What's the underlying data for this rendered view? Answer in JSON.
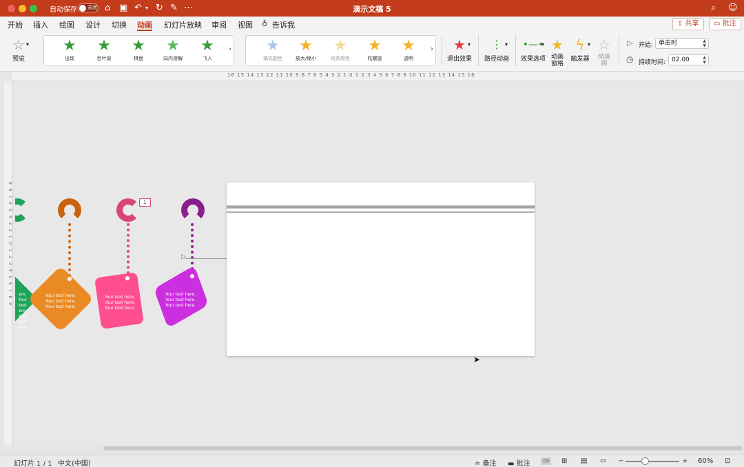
{
  "window": {
    "title": "演示文稿 5",
    "autosave_label": "自动保存",
    "autosave_state": "关闭",
    "traffic_lights": [
      "#f25f58",
      "#fbbc2e",
      "#33c748"
    ]
  },
  "tabs": [
    {
      "label": "开始"
    },
    {
      "label": "插入"
    },
    {
      "label": "绘图"
    },
    {
      "label": "设计"
    },
    {
      "label": "切换"
    },
    {
      "label": "动画",
      "active": true
    },
    {
      "label": "幻灯片放映"
    },
    {
      "label": "审阅"
    },
    {
      "label": "视图"
    },
    {
      "label": "告诉我"
    }
  ],
  "header_buttons": {
    "share": "共享",
    "comment": "批注"
  },
  "ribbon": {
    "preview": "预览",
    "entrance_effects": [
      {
        "label": "出现",
        "color": "#3a9b3a"
      },
      {
        "label": "百叶窗",
        "color": "#3a9b3a"
      },
      {
        "label": "棋盘",
        "color": "#3a9b3a"
      },
      {
        "label": "向内溶解",
        "color": "#5cb85c"
      },
      {
        "label": "飞入",
        "color": "#3a9b3a"
      }
    ],
    "emphasis_effects": [
      {
        "label": "填充颜色",
        "color": "#a9c7e8"
      },
      {
        "label": "放大/缩小",
        "color": "#f0b429"
      },
      {
        "label": "线条颜色",
        "color": "#f3d99a"
      },
      {
        "label": "陀螺旋",
        "color": "#f0b429"
      },
      {
        "label": "透明",
        "color": "#f0b429"
      }
    ],
    "exit_effects": "退出效果",
    "path_animation": "路径动画",
    "effect_options": "效果选项",
    "animation_pane": "动画\n窗格",
    "trigger": "触发器",
    "animate_text": "动画\n刷",
    "start_label": "开始:",
    "start_value": "单击时",
    "duration_label": "持续时间:",
    "duration_value": "02.00"
  },
  "ruler": {
    "horizontal": "16 15 14 13 12 11 10 9 8 7 6 5 4 3 2 1 0 1 2 3 4 5 6 7 8 9 10 11 12 13 14 15 16",
    "vertical": "9 8 7 6 5 4 3 2 1 0 1 2 3 4 5 6 7 8 9"
  },
  "offslide_shapes": [
    {
      "color": "#c8630f",
      "diamond": "#ea8a25",
      "text": "Your text here. Your text here. Your text here."
    },
    {
      "color": "#d9457a",
      "diamond": "#ff4f8f",
      "text": "Your text here. Your text here. Your text here."
    },
    {
      "color": "#8a1e8c",
      "diamond": "#cc2fe0",
      "text": "Your text here. Your text here. Your text here."
    }
  ],
  "partial_shape": {
    "color": "#1fa35a",
    "text": "ere. Your text ere. Your text here."
  },
  "animation_tag": "1",
  "statusbar": {
    "slide": "幻灯片 1 / 1",
    "language": "中文(中国)",
    "notes": "备注",
    "comments": "批注",
    "zoom": "60%",
    "zoom_level": 0.6
  }
}
